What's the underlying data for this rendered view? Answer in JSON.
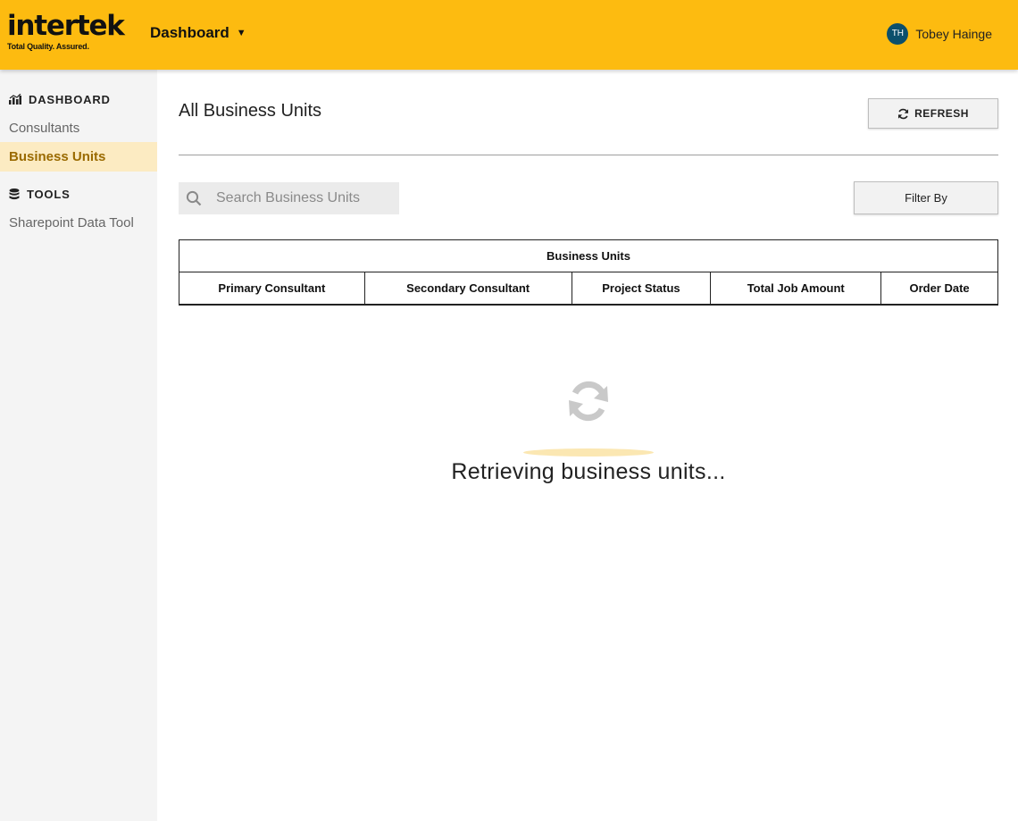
{
  "header": {
    "logo_word": "intertek",
    "logo_tagline": "Total Quality. Assured.",
    "nav_dropdown": "Dashboard",
    "user_initials": "TH",
    "user_name": "Tobey Hainge",
    "colors": {
      "bar": "#FDBB10",
      "avatar": "#0B4F6C"
    }
  },
  "sidebar": {
    "sections": [
      {
        "heading": "DASHBOARD",
        "icon": "chart-bars-icon",
        "items": [
          "Consultants",
          "Business Units"
        ]
      },
      {
        "heading": "TOOLS",
        "icon": "database-icon",
        "items": [
          "Sharepoint Data Tool"
        ]
      }
    ],
    "active_item": "Business Units"
  },
  "main": {
    "title": "All Business Units",
    "refresh_label": "REFRESH",
    "search_placeholder": "Search Business Units",
    "filter_label": "Filter By",
    "table": {
      "group_header": "Business Units",
      "columns": [
        "Primary Consultant",
        "Secondary Consultant",
        "Project Status",
        "Total Job Amount",
        "Order Date"
      ]
    },
    "loading_text": "Retrieving business units..."
  }
}
